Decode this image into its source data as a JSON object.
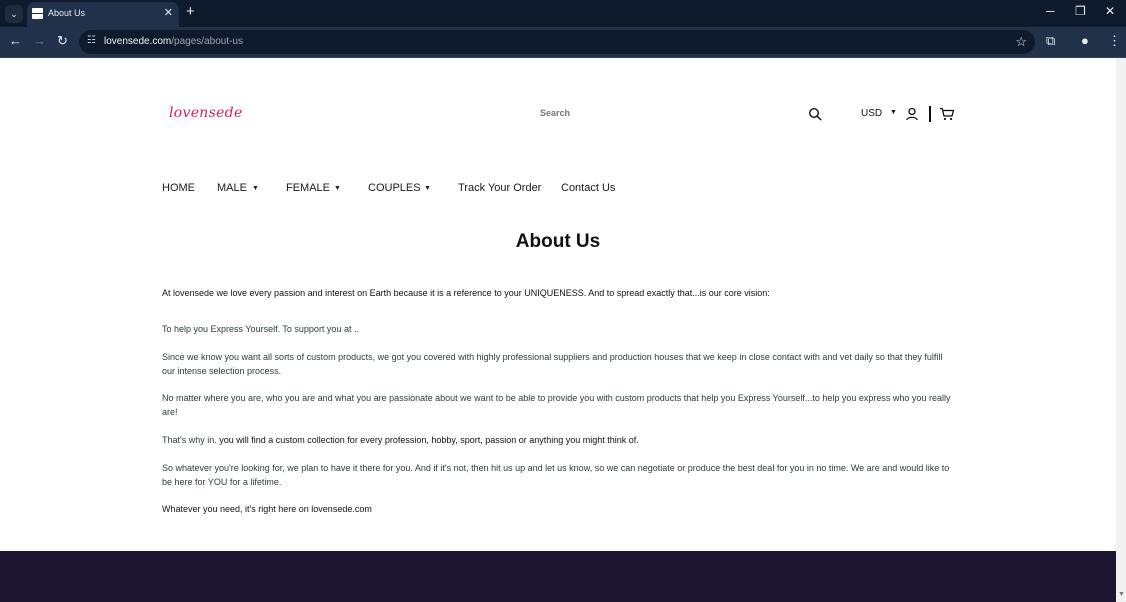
{
  "browser": {
    "tab_title": "About Us",
    "url_domain": "lovensede.com",
    "url_path": "/pages/about-us"
  },
  "header": {
    "logo": "lovensede",
    "search_placeholder": "Search",
    "currency": "USD"
  },
  "nav": {
    "items": [
      "HOME",
      "MALE",
      "FEMALE",
      "COUPLES",
      "Track Your Order",
      "Contact Us"
    ]
  },
  "content": {
    "title": "About Us",
    "p1": "At lovensede  we love every passion and interest on Earth because it is a reference to your UNIQUENESS. And to spread exactly that...is our core vision:",
    "p2": "To help you Express Yourself. To support you at ..",
    "p3": "Since we know you want all sorts of custom products, we got you covered with highly professional suppliers and production houses that we keep in close contact with and vet daily so that they fulfill our intense selection process.",
    "p4": "No matter where you are, who you are and what you are passionate about we want to be able to provide you with custom products that help you Express Yourself...to help you express who you really are!",
    "p5_lead": "That's why in.",
    "p5_rest": " you will find a custom collection for every profession, hobby, sport, passion or anything you might think of.",
    "p6": "So whatever you're looking for, we plan to have it there for you. And if it's not, then hit us up and let us know, so we can negotiate or produce the best deal for you in no time. We are and would like to be here for YOU for a lifetime.",
    "p7": "Whatever you need, it's right here on lovensede.com"
  },
  "colors": {
    "logo": "#d51c5c",
    "footer": "#1c1630",
    "chrome_dark": "#0f1b2d",
    "chrome_toolbar": "#22314a"
  }
}
